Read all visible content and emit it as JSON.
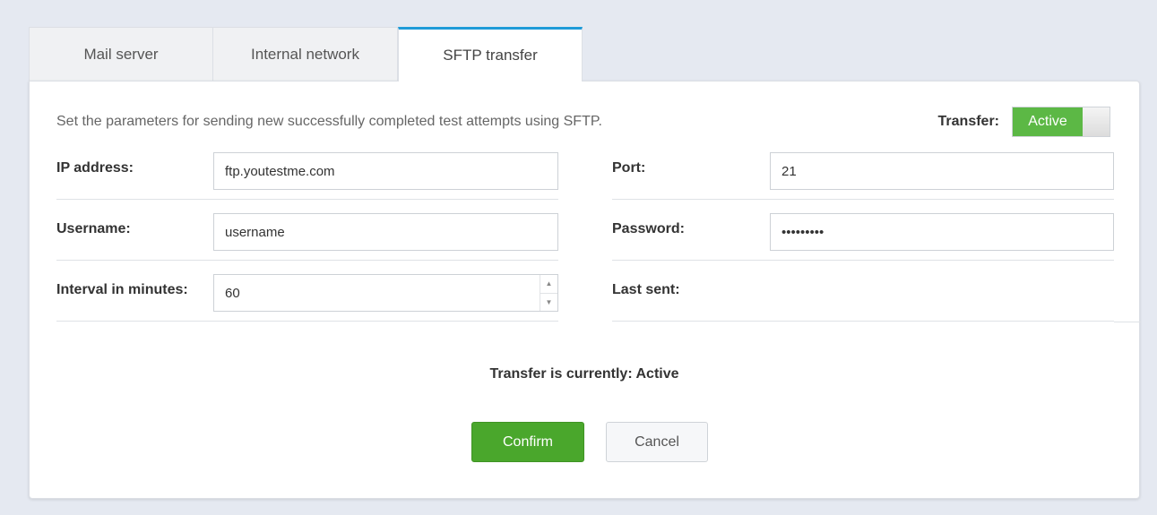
{
  "tabs": [
    {
      "label": "Mail server"
    },
    {
      "label": "Internal network"
    },
    {
      "label": "SFTP transfer"
    }
  ],
  "description": "Set the parameters for sending new successfully completed test attempts using SFTP.",
  "transfer_toggle": {
    "label": "Transfer:",
    "state": "Active",
    "on_color": "#5cb845"
  },
  "fields": {
    "ip_address": {
      "label": "IP address:",
      "value": "ftp.youtestme.com"
    },
    "username": {
      "label": "Username:",
      "value": "username"
    },
    "interval": {
      "label": "Interval in minutes:",
      "value": "60"
    },
    "port": {
      "label": "Port:",
      "value": "21"
    },
    "password": {
      "label": "Password:",
      "value": "password1"
    },
    "last_sent": {
      "label": "Last sent:",
      "value": ""
    }
  },
  "status_text": "Transfer is currently: Active",
  "buttons": {
    "confirm": "Confirm",
    "cancel": "Cancel"
  },
  "colors": {
    "accent": "#1f9bd8",
    "confirm": "#4aa72c"
  }
}
